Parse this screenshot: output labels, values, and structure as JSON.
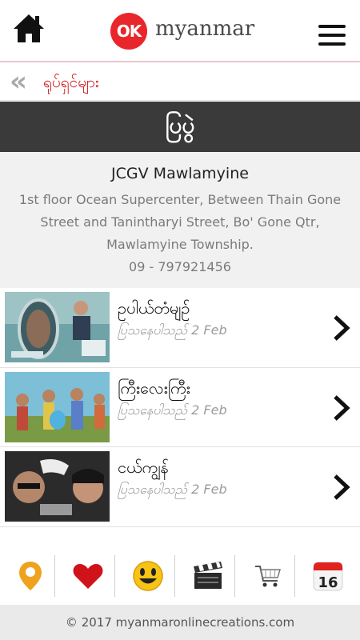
{
  "header": {
    "logo_badge": "OK",
    "logo_text": "myanmar"
  },
  "breadcrumb": {
    "label": "ရုပ်ရှင်များ"
  },
  "section": {
    "title": "ပြပွဲ"
  },
  "cinema": {
    "name": "JCGV Mawlamyine",
    "address": "1st floor Ocean Supercenter, Between Thain Gone Street and Tanintharyi Street, Bo' Gone Qtr, Mawlamyine Township.",
    "phone": "09 - 797921456"
  },
  "movies": [
    {
      "title": "ဥပါယ်တံမျဉ်",
      "date": "ပြသနေပါသည် 2 Feb"
    },
    {
      "title": "ကြီးလေးကြီး",
      "date": "ပြသနေပါသည် 2 Feb"
    },
    {
      "title": "ငယ်ကျွန်",
      "date": "ပြသနေပါသည် 2 Feb"
    }
  ],
  "bottom_nav": {
    "items": [
      "location-pin-icon",
      "heart-icon",
      "smiley-icon",
      "clapperboard-icon",
      "shopping-cart-icon",
      "calendar-icon"
    ],
    "calendar_day": "16"
  },
  "footer": {
    "text": "© 2017 myanmaronlinecreations.com"
  },
  "colors": {
    "brand_red": "#e8262b",
    "section_bar": "#3a3a3a",
    "crumb_red": "#d21b22"
  }
}
